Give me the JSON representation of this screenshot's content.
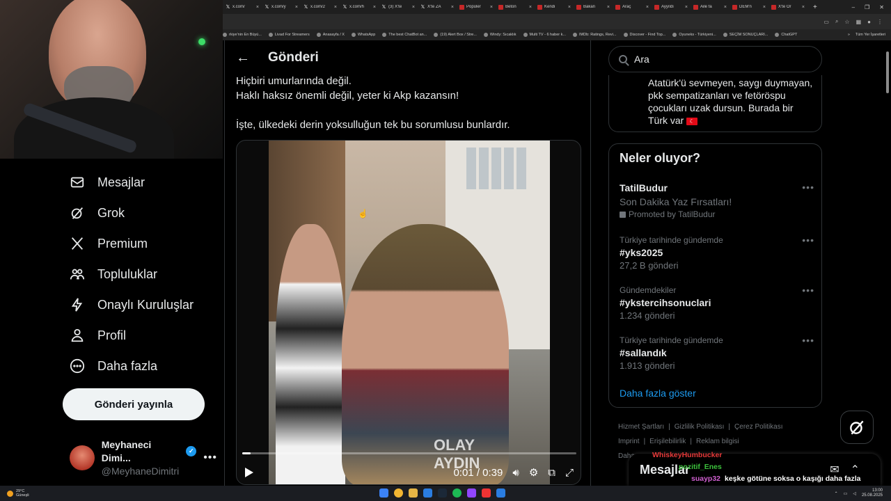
{
  "browser": {
    "tabs": [
      {
        "label": "x.com/",
        "icon": "x-logo"
      },
      {
        "label": "x.com/y",
        "icon": "x-logo"
      },
      {
        "label": "x.com/2",
        "icon": "x-logo"
      },
      {
        "label": "x.com/h",
        "icon": "x-logo"
      },
      {
        "label": "(3) X'te",
        "icon": "x-logo"
      },
      {
        "label": "X'te ZA",
        "icon": "x-logo"
      },
      {
        "label": "Popüler",
        "icon": "news-icon"
      },
      {
        "label": "Beton",
        "icon": "news-icon"
      },
      {
        "label": "Kendi",
        "icon": "news-icon"
      },
      {
        "label": "Bakan",
        "icon": "news-icon"
      },
      {
        "label": "Araç",
        "icon": "news-icon"
      },
      {
        "label": "Ayyıldı",
        "icon": "news-icon"
      },
      {
        "label": "Aile fa",
        "icon": "news-icon"
      },
      {
        "label": "DEM'n",
        "icon": "news-icon"
      },
      {
        "label": "X'te Or",
        "icon": "news-icon"
      }
    ],
    "bookmarks": [
      "rkiye'nin En Büyü...",
      "Livad For Streamers",
      "Anasayfa / X",
      "WhatsApp",
      "The best ChatBot an...",
      "(19) Alert Box / Stre...",
      "Windy: Sıcaklık",
      "Multi TV - 6 haber k...",
      "IMDb: Ratings, Revi...",
      "Discover - Find Top...",
      "Oyuneks - Türkiyeni...",
      "SEÇİM SONUÇLARI...",
      "ChatGPT"
    ],
    "bookmarks_more": "»",
    "bookmarks_all": "Tüm Yer İşaretleri"
  },
  "nav": {
    "items": [
      {
        "label": "Mesajlar",
        "icon": "envelope-icon"
      },
      {
        "label": "Grok",
        "icon": "grok-icon"
      },
      {
        "label": "Premium",
        "icon": "x-icon"
      },
      {
        "label": "Topluluklar",
        "icon": "people-icon"
      },
      {
        "label": "Onaylı Kuruluşlar",
        "icon": "lightning-icon"
      },
      {
        "label": "Profil",
        "icon": "person-icon"
      },
      {
        "label": "Daha fazla",
        "icon": "more-circle-icon"
      }
    ],
    "post_button": "Gönderi yayınla",
    "account": {
      "name": "Meyhaneci Dimi...",
      "handle": "@MeyhaneDimitri",
      "more": "•••"
    }
  },
  "main": {
    "back": "←",
    "title": "Gönderi",
    "tweet_lines": [
      "Hiçbiri umurlarında değil.",
      "Haklı haksız önemli değil, yeter ki Akp kazansın!",
      "",
      "İşte, ülkedeki derin yoksulluğun tek bu sorumlusu bunlardır."
    ],
    "video": {
      "watermark": "OLAY\nAYDIN",
      "time": "0:01 / 0:39",
      "progress": 0.026
    }
  },
  "right": {
    "search_placeholder": "Ara",
    "bio": "Atatürk'ü sevmeyen, saygı duymayan, pkk sempatizanları ve fetöröspu çocukları uzak dursun. Burada bir Türk var",
    "trends_title": "Neler oluyor?",
    "promoted": {
      "name": "TatilBudur",
      "sub": "Son Dakika Yaz Fırsatları!",
      "promo": "Promoted by TatilBudur"
    },
    "trends": [
      {
        "ctx": "Türkiye tarihinde gündemde",
        "name": "#yks2025",
        "count": "27,2 B gönderi"
      },
      {
        "ctx": "Gündemdekiler",
        "name": "#ykstercihsonuclari",
        "count": "1.234 gönderi"
      },
      {
        "ctx": "Türkiye tarihinde gündemde",
        "name": "#sallandık",
        "count": "1.913 gönderi"
      }
    ],
    "show_more": "Daha fazla göster",
    "footer": [
      "Hizmet Şartları",
      "Gizlilik Politikası",
      "Çerez Politikası",
      "Imprint",
      "Erişilebilirlik",
      "Reklam bilgisi",
      "Daha"
    ]
  },
  "messages": {
    "label": "Mesajlar"
  },
  "chat": [
    {
      "user": "WhiskeyHumbucker",
      "msg": "",
      "color": "#e83a3a"
    },
    {
      "user": "pozitif_Enes",
      "msg": "",
      "color": "#3cc13c"
    },
    {
      "user": "suayp32",
      "msg": "keşke götüne soksa o kaşığı daha fazla izlenirdi :D",
      "color": "#d05fd0"
    }
  ],
  "taskbar": {
    "weather_temp": "29°C",
    "weather_desc": "Güneşli",
    "time": "13:00",
    "date": "25.08.2025"
  }
}
